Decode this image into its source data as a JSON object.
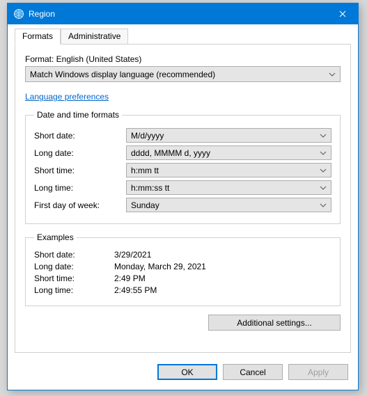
{
  "window": {
    "title": "Region"
  },
  "tabs": {
    "formats": "Formats",
    "administrative": "Administrative"
  },
  "format": {
    "label": "Format: English (United States)",
    "value": "Match Windows display language (recommended)"
  },
  "link": "Language preferences",
  "group": {
    "legend": "Date and time formats",
    "short_date_label": "Short date:",
    "short_date_value": "M/d/yyyy",
    "long_date_label": "Long date:",
    "long_date_value": "dddd, MMMM d, yyyy",
    "short_time_label": "Short time:",
    "short_time_value": "h:mm tt",
    "long_time_label": "Long time:",
    "long_time_value": "h:mm:ss tt",
    "first_day_label": "First day of week:",
    "first_day_value": "Sunday"
  },
  "examples": {
    "legend": "Examples",
    "short_date_label": "Short date:",
    "short_date_value": "3/29/2021",
    "long_date_label": "Long date:",
    "long_date_value": "Monday, March 29, 2021",
    "short_time_label": "Short time:",
    "short_time_value": "2:49 PM",
    "long_time_label": "Long time:",
    "long_time_value": "2:49:55 PM"
  },
  "buttons": {
    "additional": "Additional settings...",
    "ok": "OK",
    "cancel": "Cancel",
    "apply": "Apply"
  }
}
